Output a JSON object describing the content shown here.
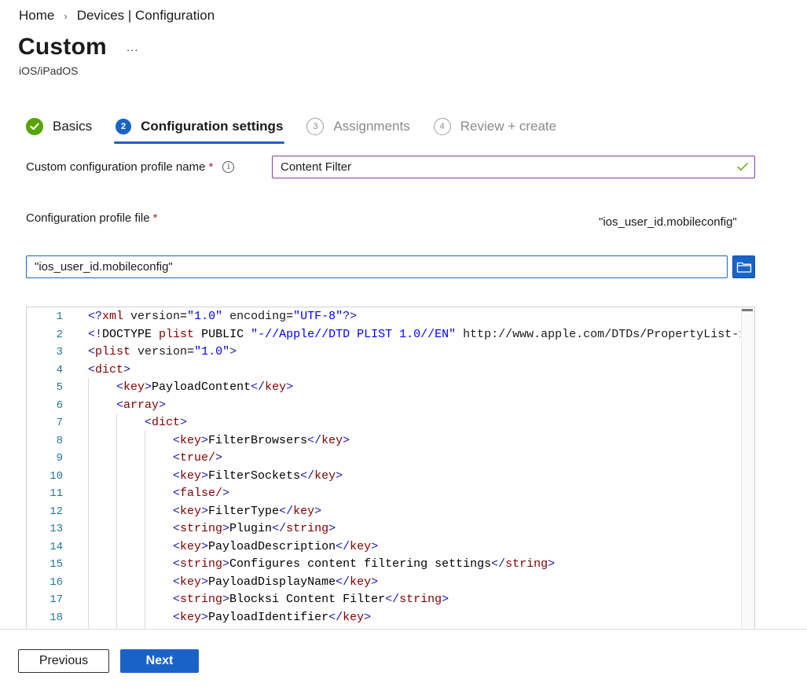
{
  "breadcrumb": {
    "home": "Home",
    "separator": "›",
    "current": "Devices | Configuration"
  },
  "page": {
    "title": "Custom",
    "more": "...",
    "subtitle": "iOS/iPadOS"
  },
  "wizard": {
    "steps": [
      {
        "number": "✓",
        "label": "Basics",
        "state": "done"
      },
      {
        "number": "2",
        "label": "Configuration settings",
        "state": "active"
      },
      {
        "number": "3",
        "label": "Assignments",
        "state": "pending"
      },
      {
        "number": "4",
        "label": "Review + create",
        "state": "pending"
      }
    ]
  },
  "form": {
    "profile_name_label": "Custom configuration profile name",
    "required_mark": "*",
    "info_icon": "i",
    "profile_name_value": "Content Filter",
    "profile_file_label": "Configuration profile file",
    "profile_file_name_display": "\"ios_user_id.mobileconfig\"",
    "profile_file_input_value": "\"ios_user_id.mobileconfig\""
  },
  "editor": {
    "line_numbers": [
      "1",
      "2",
      "3",
      "4",
      "5",
      "6",
      "7",
      "8",
      "9",
      "10",
      "11",
      "12",
      "13",
      "14",
      "15",
      "16",
      "17",
      "18"
    ],
    "lines": [
      "<?xml version=\"1.0\" encoding=\"UTF-8\"?>",
      "<!DOCTYPE plist PUBLIC \"-//Apple//DTD PLIST 1.0//EN\" \"http://www.apple.com/DTDs/PropertyList-1",
      "<plist version=\"1.0\">",
      "<dict>",
      "<key>PayloadContent</key>",
      "<array>",
      "<dict>",
      "<key>FilterBrowsers</key>",
      "<true/>",
      "<key>FilterSockets</key>",
      "<false/>",
      "<key>FilterType</key>",
      "<string>Plugin</string>",
      "<key>PayloadDescription</key>",
      "<string>Configures content filtering settings</string>",
      "<key>PayloadDisplayName</key>",
      "<string>Blocksi Content Filter</string>",
      "<key>PayloadIdentifier</key>"
    ]
  },
  "footer": {
    "previous_label": "Previous",
    "next_label": "Next"
  },
  "colors": {
    "accent": "#1a63c6",
    "success": "#57a300",
    "required": "#a4262c",
    "focus_border": "#8f3aa8"
  },
  "icons": {
    "browse": "folder-icon",
    "valid": "checkmark-icon",
    "info": "info-icon"
  }
}
